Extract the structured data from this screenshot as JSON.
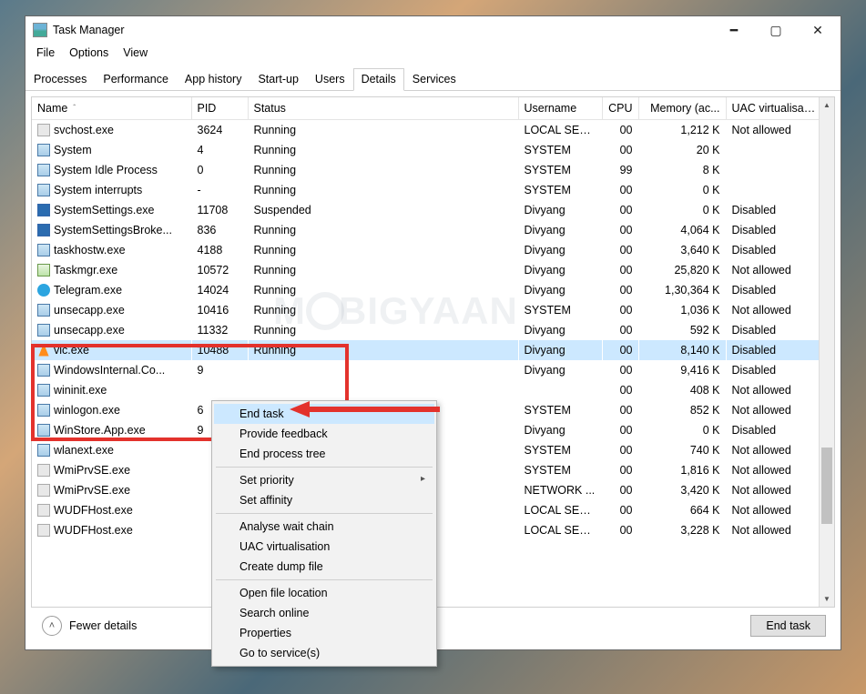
{
  "window": {
    "title": "Task Manager"
  },
  "menubar": [
    "File",
    "Options",
    "View"
  ],
  "tabs": [
    "Processes",
    "Performance",
    "App history",
    "Start-up",
    "Users",
    "Details",
    "Services"
  ],
  "activeTab": "Details",
  "columns": {
    "name": "Name",
    "pid": "PID",
    "status": "Status",
    "user": "Username",
    "cpu": "CPU",
    "mem": "Memory (ac...",
    "uac": "UAC virtualisati..."
  },
  "rows": [
    {
      "icon": "svc",
      "name": "svchost.exe",
      "pid": "3624",
      "status": "Running",
      "user": "LOCAL SER...",
      "cpu": "00",
      "mem": "1,212 K",
      "uac": "Not allowed"
    },
    {
      "icon": "app",
      "name": "System",
      "pid": "4",
      "status": "Running",
      "user": "SYSTEM",
      "cpu": "00",
      "mem": "20 K",
      "uac": ""
    },
    {
      "icon": "app",
      "name": "System Idle Process",
      "pid": "0",
      "status": "Running",
      "user": "SYSTEM",
      "cpu": "99",
      "mem": "8 K",
      "uac": ""
    },
    {
      "icon": "app",
      "name": "System interrupts",
      "pid": "-",
      "status": "Running",
      "user": "SYSTEM",
      "cpu": "00",
      "mem": "0 K",
      "uac": ""
    },
    {
      "icon": "gear",
      "name": "SystemSettings.exe",
      "pid": "11708",
      "status": "Suspended",
      "user": "Divyang",
      "cpu": "00",
      "mem": "0 K",
      "uac": "Disabled"
    },
    {
      "icon": "gear",
      "name": "SystemSettingsBroke...",
      "pid": "836",
      "status": "Running",
      "user": "Divyang",
      "cpu": "00",
      "mem": "4,064 K",
      "uac": "Disabled"
    },
    {
      "icon": "app",
      "name": "taskhostw.exe",
      "pid": "4188",
      "status": "Running",
      "user": "Divyang",
      "cpu": "00",
      "mem": "3,640 K",
      "uac": "Disabled"
    },
    {
      "icon": "chart",
      "name": "Taskmgr.exe",
      "pid": "10572",
      "status": "Running",
      "user": "Divyang",
      "cpu": "00",
      "mem": "25,820 K",
      "uac": "Not allowed"
    },
    {
      "icon": "telegram",
      "name": "Telegram.exe",
      "pid": "14024",
      "status": "Running",
      "user": "Divyang",
      "cpu": "00",
      "mem": "1,30,364 K",
      "uac": "Disabled"
    },
    {
      "icon": "app",
      "name": "unsecapp.exe",
      "pid": "10416",
      "status": "Running",
      "user": "SYSTEM",
      "cpu": "00",
      "mem": "1,036 K",
      "uac": "Not allowed"
    },
    {
      "icon": "app",
      "name": "unsecapp.exe",
      "pid": "11332",
      "status": "Running",
      "user": "Divyang",
      "cpu": "00",
      "mem": "592 K",
      "uac": "Disabled"
    },
    {
      "icon": "vlc",
      "name": "vlc.exe",
      "pid": "10488",
      "status": "Running",
      "user": "Divyang",
      "cpu": "00",
      "mem": "8,140 K",
      "uac": "Disabled",
      "selected": true
    },
    {
      "icon": "app",
      "name": "WindowsInternal.Co...",
      "pid": "9",
      "status": "",
      "user": "Divyang",
      "cpu": "00",
      "mem": "9,416 K",
      "uac": "Disabled"
    },
    {
      "icon": "app",
      "name": "wininit.exe",
      "pid": "",
      "status": "",
      "user": "",
      "cpu": "00",
      "mem": "408 K",
      "uac": "Not allowed"
    },
    {
      "icon": "app",
      "name": "winlogon.exe",
      "pid": "6",
      "status": "",
      "user": "SYSTEM",
      "cpu": "00",
      "mem": "852 K",
      "uac": "Not allowed"
    },
    {
      "icon": "app",
      "name": "WinStore.App.exe",
      "pid": "9",
      "status": "",
      "user": "Divyang",
      "cpu": "00",
      "mem": "0 K",
      "uac": "Disabled"
    },
    {
      "icon": "app",
      "name": "wlanext.exe",
      "pid": "",
      "status": "",
      "user": "SYSTEM",
      "cpu": "00",
      "mem": "740 K",
      "uac": "Not allowed"
    },
    {
      "icon": "svc",
      "name": "WmiPrvSE.exe",
      "pid": "",
      "status": "",
      "user": "SYSTEM",
      "cpu": "00",
      "mem": "1,816 K",
      "uac": "Not allowed"
    },
    {
      "icon": "svc",
      "name": "WmiPrvSE.exe",
      "pid": "",
      "status": "",
      "user": "NETWORK ...",
      "cpu": "00",
      "mem": "3,420 K",
      "uac": "Not allowed"
    },
    {
      "icon": "svc",
      "name": "WUDFHost.exe",
      "pid": "",
      "status": "",
      "user": "LOCAL SER...",
      "cpu": "00",
      "mem": "664 K",
      "uac": "Not allowed"
    },
    {
      "icon": "svc",
      "name": "WUDFHost.exe",
      "pid": "",
      "status": "",
      "user": "LOCAL SER...",
      "cpu": "00",
      "mem": "3,228 K",
      "uac": "Not allowed"
    }
  ],
  "contextMenu": {
    "endTask": "End task",
    "provideFeedback": "Provide feedback",
    "endProcessTree": "End process tree",
    "setPriority": "Set priority",
    "setAffinity": "Set affinity",
    "analyseWaitChain": "Analyse wait chain",
    "uacVirt": "UAC virtualisation",
    "createDump": "Create dump file",
    "openFileLocation": "Open file location",
    "searchOnline": "Search online",
    "properties": "Properties",
    "goToServices": "Go to service(s)"
  },
  "footer": {
    "fewer": "Fewer details",
    "endTask": "End task"
  },
  "watermark": "BIGYAAN"
}
